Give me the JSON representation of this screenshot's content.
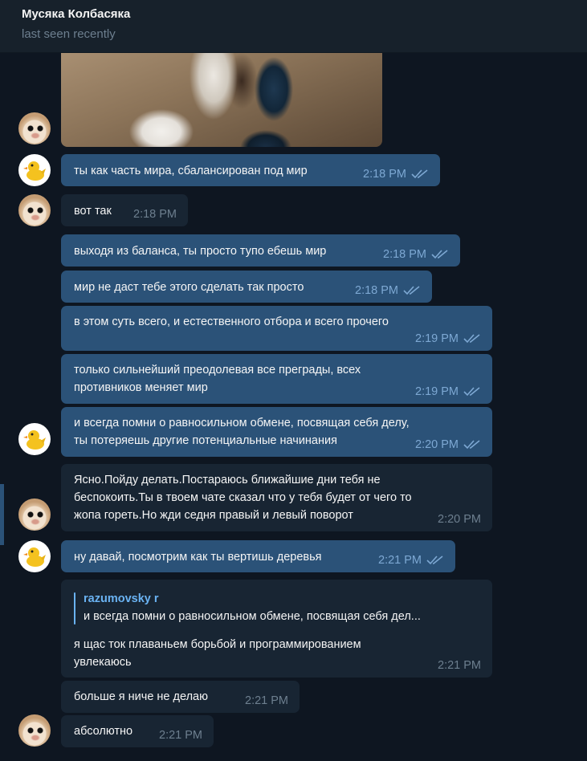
{
  "header": {
    "contact_name": "Мусяка Колбасяка",
    "status": "last seen recently"
  },
  "messages": [
    {
      "dir": "out",
      "lines": "ты как часть мира, сбалансирован под мир",
      "time": "2:18 PM"
    },
    {
      "dir": "in",
      "lines": "вот так",
      "time": "2:18 PM"
    },
    {
      "dir": "out",
      "lines": "выходя из баланса, ты просто тупо ебешь мир",
      "time": "2:18 PM"
    },
    {
      "dir": "out",
      "lines": "мир не даст тебе этого сделать так просто",
      "time": "2:18 PM"
    },
    {
      "dir": "out",
      "lines": "в этом суть всего, и естественного отбора и всего прочего",
      "time": "2:19 PM"
    },
    {
      "dir": "out",
      "lines": "только сильнейший преодолевая все преграды, всех\nпротивников меняет мир",
      "time": "2:19 PM"
    },
    {
      "dir": "out",
      "lines": "и всегда помни о равносильном обмене, посвящая себя делу,\nты потеряешь другие потенциальные начинания",
      "time": "2:20 PM"
    },
    {
      "dir": "in",
      "lines": "Ясно.Пойду делать.Постараюсь ближайшие дни тебя не\nбеспокоить.Ты в твоем чате сказал что у тебя будет от чего то\nжопа гореть.Но жди седня правый и левый поворот",
      "time": "2:20 PM"
    },
    {
      "dir": "out",
      "lines": "ну давай, посмотрим как ты вертишь деревья",
      "time": "2:21 PM"
    },
    {
      "dir": "in",
      "reply_name": "razumovsky r",
      "reply_text": "и всегда помни о равносильном обмене, посвящая себя дел...",
      "lines": "я щас ток плаваньем борьбой и программированием\nувлекаюсь",
      "time": "2:21 PM"
    },
    {
      "dir": "in",
      "lines": "больше я ниче не делаю",
      "time": "2:21 PM"
    },
    {
      "dir": "in",
      "lines": "абсолютно",
      "time": "2:21 PM"
    }
  ],
  "colors": {
    "background": "#0e1621",
    "header": "#17212b",
    "outgoing_bubble": "#2b5278",
    "incoming_bubble": "#182533",
    "accent": "#6ab3f3"
  },
  "icons": {
    "read_receipt": "double-check-icon",
    "cat_avatar": "cat-avatar",
    "duck_avatar": "duck-avatar"
  }
}
